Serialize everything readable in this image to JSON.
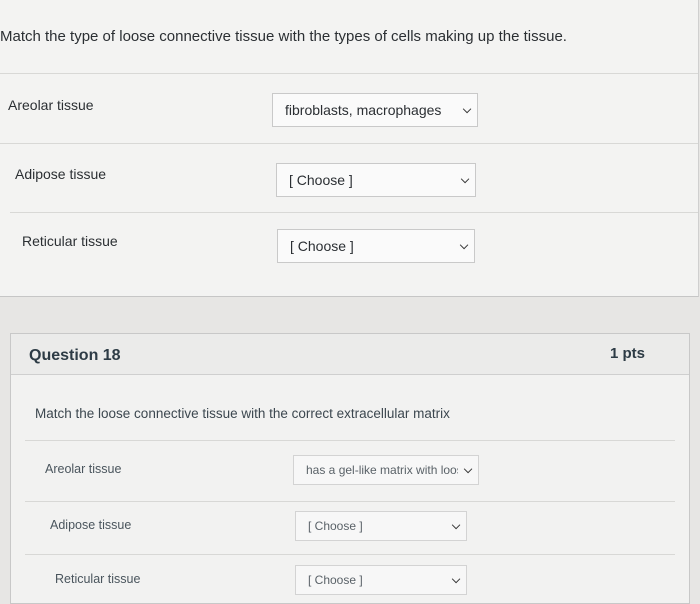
{
  "section1": {
    "instruction": "Match the type of loose connective tissue with the types of cells making up the tissue.",
    "rows": [
      {
        "label": "Areolar tissue",
        "selected": "fibroblasts, macrophages"
      },
      {
        "label": "Adipose tissue",
        "selected": "[ Choose ]"
      },
      {
        "label": "Reticular tissue",
        "selected": "[ Choose ]"
      }
    ]
  },
  "question18": {
    "title": "Question 18",
    "points": "1 pts",
    "instruction": "Match the loose connective tissue with the correct extracellular matrix",
    "rows": [
      {
        "label": "Areolar tissue",
        "selected": "has a gel-like matrix with loos"
      },
      {
        "label": "Adipose tissue",
        "selected": "[ Choose ]"
      },
      {
        "label": "Reticular tissue",
        "selected": "[ Choose ]"
      }
    ]
  }
}
